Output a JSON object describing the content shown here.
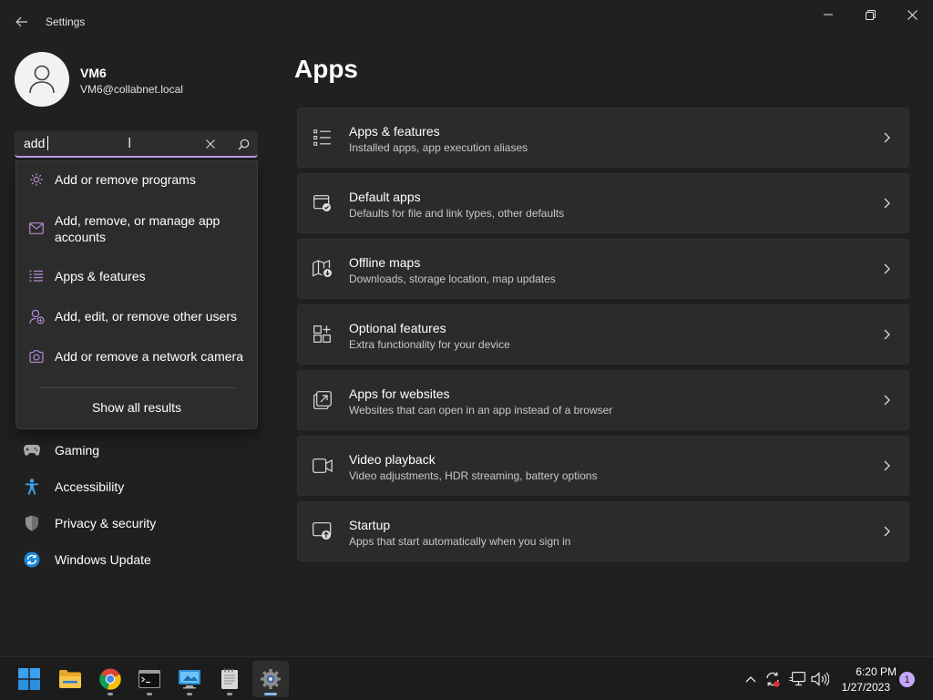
{
  "window": {
    "title": "Settings",
    "minimize_icon": "minimize-icon",
    "maximize_icon": "restore-icon",
    "close_icon": "close-icon"
  },
  "profile": {
    "name": "VM6",
    "email": "VM6@collabnet.local"
  },
  "search": {
    "value": "add",
    "accent": "#b99be8"
  },
  "suggestions": {
    "items": [
      {
        "label": "Add or remove programs",
        "icon": "gear-icon"
      },
      {
        "label": "Add, remove, or manage app accounts",
        "icon": "mail-icon"
      },
      {
        "label": "Apps & features",
        "icon": "list-icon"
      },
      {
        "label": "Add, edit, or remove other users",
        "icon": "person-add-icon"
      },
      {
        "label": "Add or remove a network camera",
        "icon": "camera-icon"
      }
    ],
    "show_all": "Show all results"
  },
  "nav": {
    "items": [
      {
        "label": "Gaming",
        "icon": "gamepad-icon"
      },
      {
        "label": "Accessibility",
        "icon": "accessibility-icon"
      },
      {
        "label": "Privacy & security",
        "icon": "shield-icon"
      },
      {
        "label": "Windows Update",
        "icon": "update-icon"
      }
    ]
  },
  "page": {
    "title": "Apps",
    "cards": [
      {
        "title": "Apps & features",
        "subtitle": "Installed apps, app execution aliases",
        "icon": "apps-list-icon"
      },
      {
        "title": "Default apps",
        "subtitle": "Defaults for file and link types, other defaults",
        "icon": "default-apps-icon"
      },
      {
        "title": "Offline maps",
        "subtitle": "Downloads, storage location, map updates",
        "icon": "map-download-icon"
      },
      {
        "title": "Optional features",
        "subtitle": "Extra functionality for your device",
        "icon": "optional-features-icon"
      },
      {
        "title": "Apps for websites",
        "subtitle": "Websites that can open in an app instead of a browser",
        "icon": "open-in-app-icon"
      },
      {
        "title": "Video playback",
        "subtitle": "Video adjustments, HDR streaming, battery options",
        "icon": "video-icon"
      },
      {
        "title": "Startup",
        "subtitle": "Apps that start automatically when you sign in",
        "icon": "startup-icon"
      }
    ]
  },
  "taskbar": {
    "apps": [
      "start-icon",
      "file-explorer-icon",
      "chrome-icon",
      "terminal-icon",
      "remote-desktop-icon",
      "notepad-icon",
      "settings-icon"
    ],
    "tray": [
      "chevron-up-icon",
      "sync-icon",
      "network-icon",
      "volume-icon"
    ],
    "time": "6:20 PM",
    "date": "1/27/2023",
    "notification_count": "1"
  }
}
